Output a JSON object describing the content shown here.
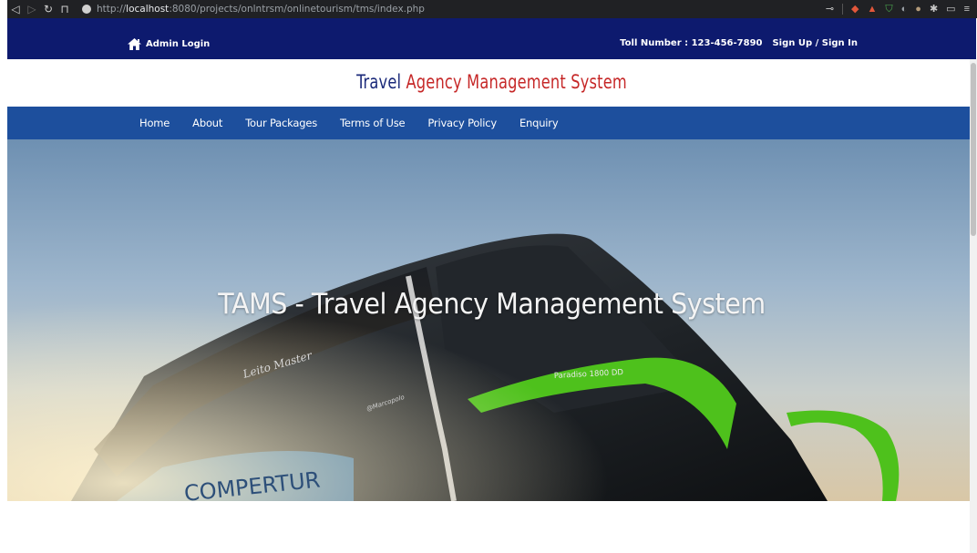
{
  "browser": {
    "url_prefix": "http://",
    "url_host": "localhost",
    "url_path": ":8080/projects/onlntrsm/onlinetourism/tms/index.php"
  },
  "topbar": {
    "admin_login": "Admin Login",
    "toll_number": "Toll Number : 123-456-7890",
    "signup_signin": "Sign Up / Sign In"
  },
  "header": {
    "title_part1": "Travel",
    "title_part2": "Agency Management System"
  },
  "nav": {
    "items": [
      "Home",
      "About",
      "Tour Packages",
      "Terms of Use",
      "Privacy Policy",
      "Enquiry"
    ]
  },
  "hero": {
    "title": "TAMS - Travel Agency Management System",
    "bus_text_1": "Leito Master",
    "bus_text_2": "Paradiso 1800 DD",
    "bus_text_3": "@Marcopolo",
    "bus_text_4": "COMPERTUR"
  },
  "colors": {
    "topbar": "#0d1a6e",
    "navbar": "#1d4f9d",
    "title_blue": "#1b2a7a",
    "title_red": "#c62828"
  }
}
